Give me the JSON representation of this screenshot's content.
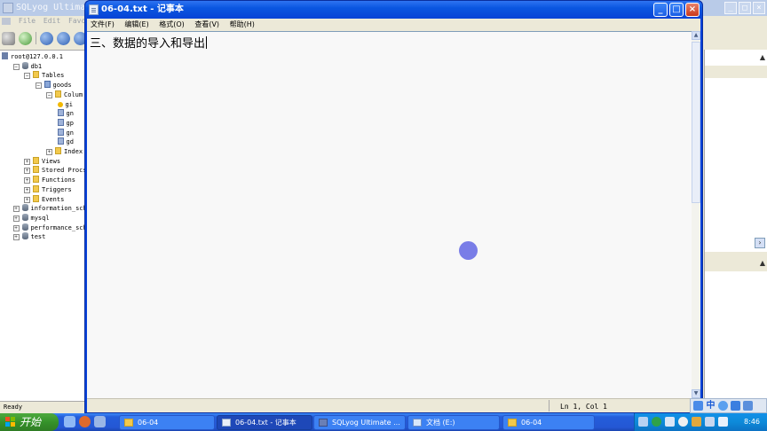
{
  "sqlyog": {
    "title": "SQLyog Ultimate",
    "menu": [
      "File",
      "Edit",
      "Favorit"
    ],
    "status": "Ready",
    "tree": [
      {
        "label": "root@127.0.0.1",
        "icon": "server-icon",
        "indent": 0,
        "expander": ""
      },
      {
        "label": "db1",
        "icon": "database-icon",
        "indent": 1,
        "expander": "−"
      },
      {
        "label": "Tables",
        "icon": "folder-icon",
        "indent": 2,
        "expander": "−"
      },
      {
        "label": "goods",
        "icon": "table-icon",
        "indent": 3,
        "expander": "−"
      },
      {
        "label": "Colum",
        "icon": "folder-icon",
        "indent": 4,
        "expander": "−"
      },
      {
        "label": "gi",
        "icon": "key-icon",
        "indent": 5,
        "expander": ""
      },
      {
        "label": "gn",
        "icon": "column-icon",
        "indent": 5,
        "expander": ""
      },
      {
        "label": "gp",
        "icon": "column-icon",
        "indent": 5,
        "expander": ""
      },
      {
        "label": "gn",
        "icon": "column-icon",
        "indent": 5,
        "expander": ""
      },
      {
        "label": "gd",
        "icon": "column-icon",
        "indent": 5,
        "expander": ""
      },
      {
        "label": "Index",
        "icon": "folder-icon",
        "indent": 4,
        "expander": "+"
      },
      {
        "label": "Views",
        "icon": "folder-icon",
        "indent": 2,
        "expander": "+"
      },
      {
        "label": "Stored Procs",
        "icon": "folder-icon",
        "indent": 2,
        "expander": "+"
      },
      {
        "label": "Functions",
        "icon": "folder-icon",
        "indent": 2,
        "expander": "+"
      },
      {
        "label": "Triggers",
        "icon": "folder-icon",
        "indent": 2,
        "expander": "+"
      },
      {
        "label": "Events",
        "icon": "folder-icon",
        "indent": 2,
        "expander": "+"
      },
      {
        "label": "information_sch",
        "icon": "database-icon",
        "indent": 1,
        "expander": "+"
      },
      {
        "label": "mysql",
        "icon": "database-icon",
        "indent": 1,
        "expander": "+"
      },
      {
        "label": "performance_sch",
        "icon": "database-icon",
        "indent": 1,
        "expander": "+"
      },
      {
        "label": "test",
        "icon": "database-icon",
        "indent": 1,
        "expander": "+"
      }
    ]
  },
  "notepad": {
    "title": "06-04.txt - 记事本",
    "menu": {
      "file": "文件(F)",
      "edit": "编辑(E)",
      "format": "格式(O)",
      "view": "查看(V)",
      "help": "帮助(H)"
    },
    "content": "三、数据的导入和导出",
    "status_position": "Ln 1, Col 1"
  },
  "taskbar": {
    "start_label": "开始",
    "tasks": [
      {
        "label": "06-04",
        "icon": "folder-icon",
        "active": false
      },
      {
        "label": "06-04.txt - 记事本",
        "icon": "notepad-icon",
        "active": true
      },
      {
        "label": "SQLyog Ultimate ...",
        "icon": "sqlyog-icon",
        "active": false
      },
      {
        "label": "文档 (E:)",
        "icon": "document-icon",
        "active": false
      },
      {
        "label": "06-04",
        "icon": "folder-icon",
        "active": false
      }
    ],
    "clock": "8:46"
  },
  "ime": {
    "mode": "中"
  }
}
